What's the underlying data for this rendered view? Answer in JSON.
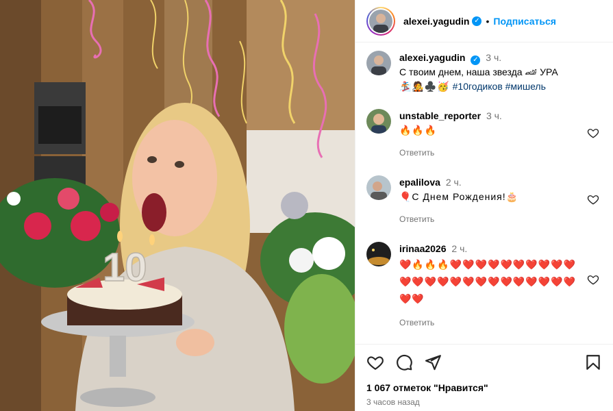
{
  "header": {
    "username": "alexei.yagudin",
    "dot": "•",
    "follow_label": "Подписаться"
  },
  "caption": {
    "username": "alexei.yagudin",
    "time": "3 ч.",
    "text_line1": "С твоим днем, наша звезда 🏎 УРА",
    "emojis": "🏂🧑‍🎤♣️🥳",
    "hashtags": "#10годиков #мишель"
  },
  "comments": [
    {
      "username": "unstable_reporter",
      "time": "3 ч.",
      "text": "🔥🔥🔥",
      "reply": "Ответить"
    },
    {
      "username": "epalilova",
      "time": "2 ч.",
      "text": "🎈С Днем Рождения!🎂",
      "reply": "Ответить"
    },
    {
      "username": "irinaa2026",
      "time": "2 ч.",
      "text": "❤️🔥🔥🔥❤️❤️❤️❤️❤️❤️❤️❤️❤️❤️❤️❤️❤️❤️❤️❤️❤️❤️❤️❤️❤️❤️❤️❤️❤️❤️",
      "reply": "Ответить"
    }
  ],
  "footer": {
    "likes": "1 067 отметок \"Нравится\"",
    "ago": "3 часов назад"
  },
  "photo": {
    "candle_number": "10"
  },
  "colors": {
    "link": "#0095f6",
    "hashtag": "#00376b",
    "heart_red": "#ed4956"
  }
}
